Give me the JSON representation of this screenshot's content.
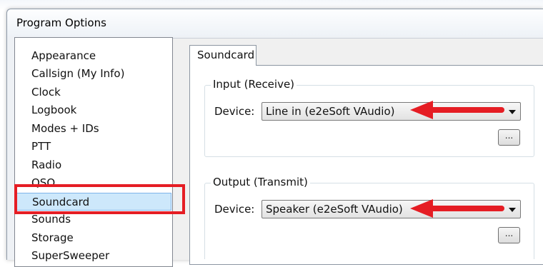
{
  "window": {
    "title": "Program Options"
  },
  "sidebar": {
    "items": [
      {
        "label": "Appearance"
      },
      {
        "label": "Callsign (My Info)"
      },
      {
        "label": "Clock"
      },
      {
        "label": "Logbook"
      },
      {
        "label": "Modes + IDs"
      },
      {
        "label": "PTT"
      },
      {
        "label": "Radio"
      },
      {
        "label": "QSO"
      },
      {
        "label": "Soundcard",
        "selected": true
      },
      {
        "label": "Sounds"
      },
      {
        "label": "Storage"
      },
      {
        "label": "SuperSweeper"
      }
    ]
  },
  "tabs": [
    {
      "label": "Soundcard",
      "active": true
    }
  ],
  "input_group": {
    "title": "Input (Receive)",
    "device_label": "Device:",
    "device_value": "Line in (e2eSoft VAudio)",
    "browse_label": "..."
  },
  "output_group": {
    "title": "Output (Transmit)",
    "device_label": "Device:",
    "device_value": "Speaker (e2eSoft VAudio)",
    "browse_label": "..."
  },
  "colors": {
    "annotation_red": "#e51d24",
    "selection_fill": "#cde8fb",
    "selection_border": "#7eb4ea"
  }
}
